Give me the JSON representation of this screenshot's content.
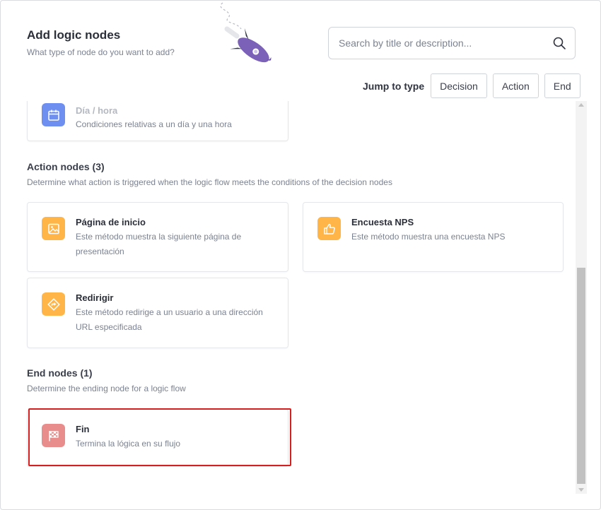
{
  "header": {
    "title": "Add logic nodes",
    "subtitle": "What type of node do you want to add?"
  },
  "search": {
    "placeholder": "Search by title or description..."
  },
  "jump": {
    "label": "Jump to type",
    "buttons": [
      "Decision",
      "Action",
      "End"
    ]
  },
  "decision_partial": {
    "name": "Día / hora",
    "desc": "Condiciones relativas a un día y una hora",
    "icon": "calendar-icon"
  },
  "action_section": {
    "title": "Action nodes (3)",
    "subtitle": "Determine what action is triggered when the logic flow meets the conditions of the decision nodes",
    "items": [
      {
        "name": "Página de inicio",
        "desc": "Este método muestra la siguiente página de presentación",
        "icon": "image-icon"
      },
      {
        "name": "Encuesta NPS",
        "desc": "Este método muestra una encuesta NPS",
        "icon": "thumbs-up-icon"
      },
      {
        "name": "Redirigir",
        "desc": "Este método redirige a un usuario a una dirección URL especificada",
        "icon": "redirect-icon"
      }
    ]
  },
  "end_section": {
    "title": "End nodes (1)",
    "subtitle": "Determine the ending node for a logic flow",
    "items": [
      {
        "name": "Fin",
        "desc": "Termina la lógica en su flujo",
        "icon": "checkered-flag-icon"
      }
    ]
  },
  "colors": {
    "decision_icon": "#6f8ff0",
    "action_icon": "#ffb547",
    "end_icon": "#e88c8c",
    "highlight": "#d61f1f",
    "rocket": "#6a4fa3"
  }
}
